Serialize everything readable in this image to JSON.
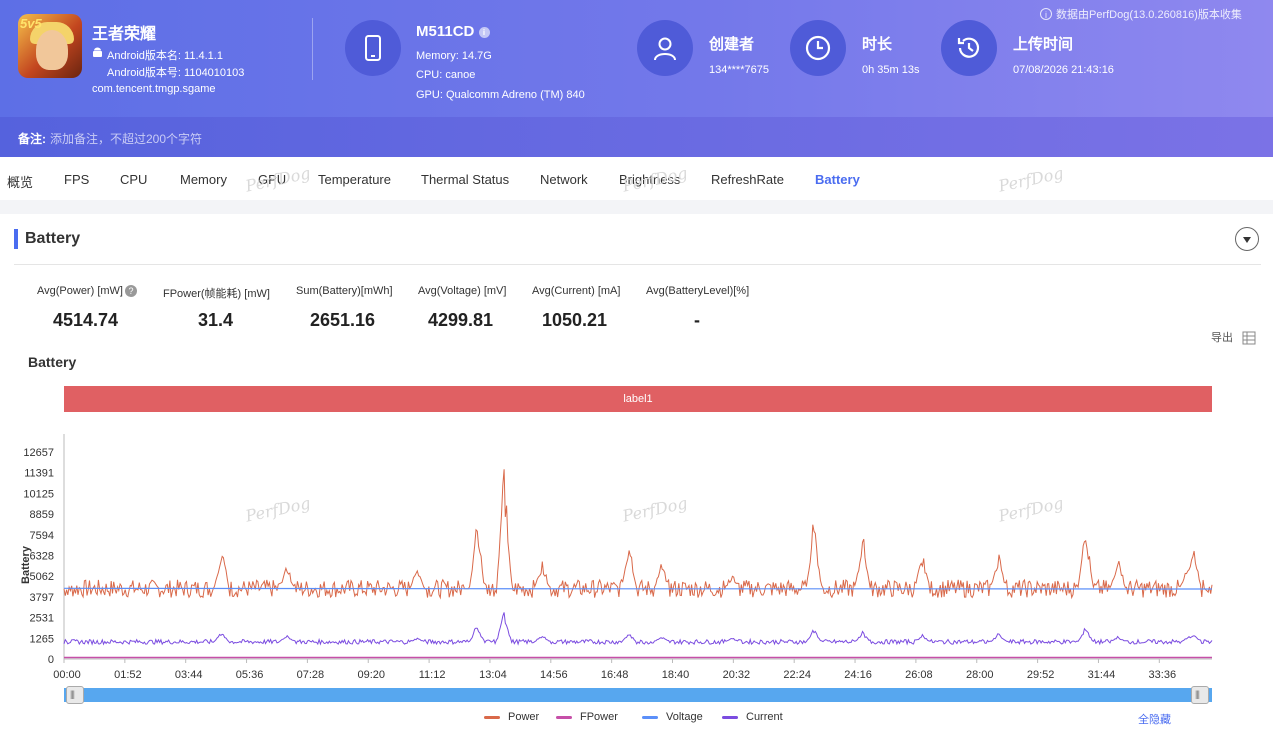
{
  "header": {
    "app": {
      "name": "王者荣耀",
      "version_name": "Android版本名: 11.4.1.1",
      "version_code": "Android版本号: 1104010103",
      "package": "com.tencent.tmgp.sgame",
      "badge": "5v5"
    },
    "device": {
      "model": "M511CD",
      "memory": "Memory: 14.7G",
      "cpu": "CPU: canoe",
      "gpu": "GPU: Qualcomm Adreno (TM) 840",
      "icon": "phone-icon"
    },
    "creator": {
      "label": "创建者",
      "value": "134****7675",
      "icon": "user-icon"
    },
    "duration": {
      "label": "时长",
      "value": "0h 35m 13s",
      "icon": "clock-icon"
    },
    "upload": {
      "label": "上传时间",
      "value": "07/08/2026 21:43:16",
      "icon": "history-icon"
    },
    "source_note": "数据由PerfDog(13.0.260816)版本收集"
  },
  "note": {
    "label": "备注:",
    "placeholder": "添加备注，不超过200个字符"
  },
  "tabs": [
    "概览",
    "FPS",
    "CPU",
    "Memory",
    "GPU",
    "Temperature",
    "Thermal Status",
    "Network",
    "Brightness",
    "RefreshRate",
    "Battery"
  ],
  "active_tab": "Battery",
  "export_label": "导出",
  "watermark": "PerfDog",
  "section": {
    "title": "Battery"
  },
  "stats": [
    {
      "label": "Avg(Power) [mW]",
      "value": "4514.74"
    },
    {
      "label": "FPower(帧能耗) [mW]",
      "value": "31.4"
    },
    {
      "label": "Sum(Battery)[mWh]",
      "value": "2651.16"
    },
    {
      "label": "Avg(Voltage) [mV]",
      "value": "4299.81"
    },
    {
      "label": "Avg(Current) [mA]",
      "value": "1050.21"
    },
    {
      "label": "Avg(BatteryLevel)[%]",
      "value": "-"
    }
  ],
  "chart_data": {
    "type": "line",
    "title": "Battery",
    "ylabel": "Battery",
    "label_band": "label1",
    "ylim": [
      0,
      12657
    ],
    "y_ticks": [
      0,
      1265,
      2531,
      3797,
      5062,
      6328,
      7594,
      8859,
      10125,
      11391,
      12657
    ],
    "x_ticks": [
      "00:00",
      "01:52",
      "03:44",
      "05:36",
      "07:28",
      "09:20",
      "11:12",
      "13:04",
      "14:56",
      "16:48",
      "18:40",
      "20:32",
      "22:24",
      "24:16",
      "26:08",
      "28:00",
      "29:52",
      "31:44",
      "33:36"
    ],
    "x_range_seconds": [
      0,
      2113
    ],
    "series": [
      {
        "name": "Power",
        "color": "#d9694a",
        "baseline": 4300,
        "peaks": [
          [
            0,
            3500
          ],
          [
            290,
            7100
          ],
          [
            410,
            5900
          ],
          [
            650,
            5700
          ],
          [
            750,
            4300
          ],
          [
            760,
            9000
          ],
          [
            810,
            12600
          ],
          [
            880,
            6100
          ],
          [
            1040,
            7600
          ],
          [
            1100,
            6000
          ],
          [
            1230,
            5200
          ],
          [
            1380,
            9300
          ],
          [
            1470,
            7900
          ],
          [
            1580,
            6600
          ],
          [
            1720,
            6700
          ],
          [
            1880,
            8900
          ],
          [
            1940,
            6500
          ],
          [
            2070,
            6200
          ],
          [
            2080,
            7100
          ],
          [
            2113,
            3800
          ]
        ]
      },
      {
        "name": "FPower",
        "color": "#c64fa8",
        "values": [
          30,
          31,
          32,
          31,
          30
        ]
      },
      {
        "name": "Voltage",
        "color": "#5b8ff9",
        "values": [
          4320,
          4310,
          4300,
          4295,
          4290,
          4285,
          4280
        ]
      },
      {
        "name": "Current",
        "color": "#7b4ce0",
        "baseline": 1050,
        "peaks": [
          [
            0,
            700
          ],
          [
            290,
            1700
          ],
          [
            410,
            1500
          ],
          [
            650,
            1300
          ],
          [
            760,
            2200
          ],
          [
            810,
            3000
          ],
          [
            880,
            1500
          ],
          [
            1040,
            1600
          ],
          [
            1100,
            1400
          ],
          [
            1230,
            1300
          ],
          [
            1380,
            1900
          ],
          [
            1470,
            1700
          ],
          [
            1580,
            1500
          ],
          [
            1720,
            1600
          ],
          [
            1880,
            2000
          ],
          [
            1940,
            1400
          ],
          [
            2070,
            1400
          ],
          [
            2080,
            1600
          ],
          [
            2113,
            900
          ]
        ]
      }
    ]
  },
  "legend_hide_all": "全隐藏"
}
